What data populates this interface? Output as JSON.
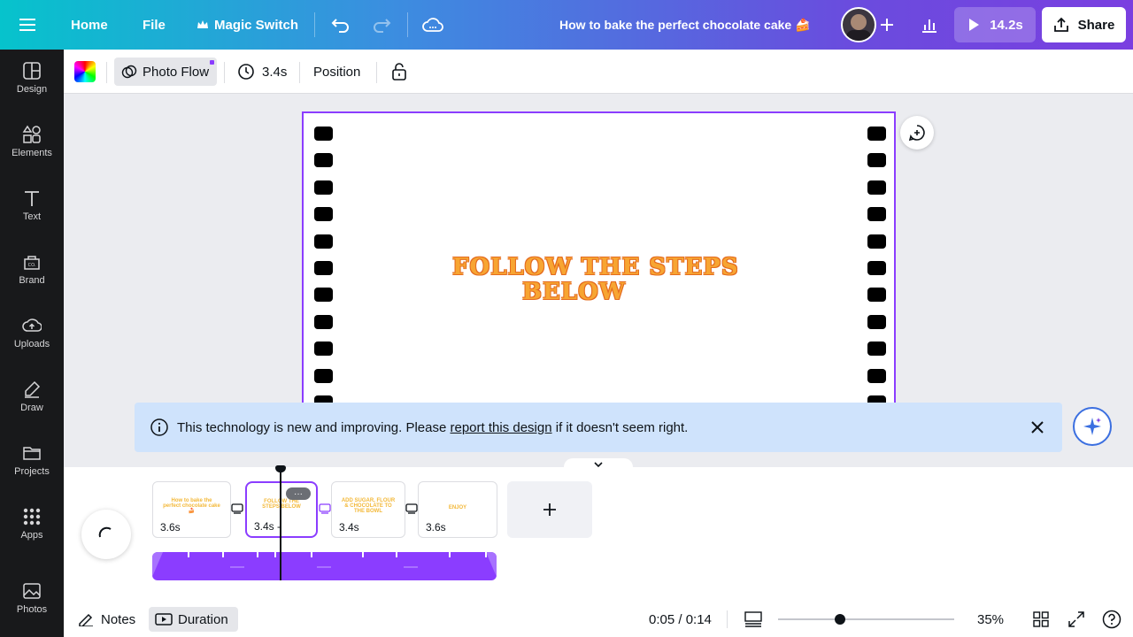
{
  "topbar": {
    "home": "Home",
    "file": "File",
    "magic_switch": "Magic Switch",
    "title": "How to bake the perfect chocolate cake 🍰",
    "play_duration": "14.2s",
    "share": "Share"
  },
  "sidebar": {
    "items": [
      {
        "label": "Design",
        "icon": "design-icon"
      },
      {
        "label": "Elements",
        "icon": "elements-icon"
      },
      {
        "label": "Text",
        "icon": "text-icon"
      },
      {
        "label": "Brand",
        "icon": "brand-icon"
      },
      {
        "label": "Uploads",
        "icon": "uploads-icon"
      },
      {
        "label": "Draw",
        "icon": "draw-icon"
      },
      {
        "label": "Projects",
        "icon": "projects-icon"
      },
      {
        "label": "Apps",
        "icon": "apps-icon"
      },
      {
        "label": "Photos",
        "icon": "photos-icon"
      }
    ]
  },
  "toolbar": {
    "transition": "Photo Flow",
    "duration": "3.4s",
    "position": "Position"
  },
  "page": {
    "headline_line1": "FOLLOW THE STEPS",
    "headline_line2": "BELOW"
  },
  "banner": {
    "text_before": "This technology is new and improving. Please ",
    "link": "report this design",
    "text_after": " if it doesn't seem right."
  },
  "timeline": {
    "pages": [
      {
        "duration": "3.6s",
        "mini": "How to bake the perfect chocolate cake 🍰"
      },
      {
        "duration": "3.4s -",
        "mini": "FOLLOW THE STEPS BELOW"
      },
      {
        "duration": "3.4s",
        "mini": "ADD SUGAR, FLOUR & CHOCOLATE TO THE BOWL"
      },
      {
        "duration": "3.6s",
        "mini": "ENJOY"
      }
    ],
    "more": "···"
  },
  "bottom": {
    "notes": "Notes",
    "duration": "Duration",
    "time": "0:05 / 0:14",
    "zoom": "35%",
    "zoom_level": 0.35
  },
  "colors": {
    "accent": "#8b3dff",
    "headline": "#f7a532",
    "banner_bg": "#cfe3fc"
  }
}
